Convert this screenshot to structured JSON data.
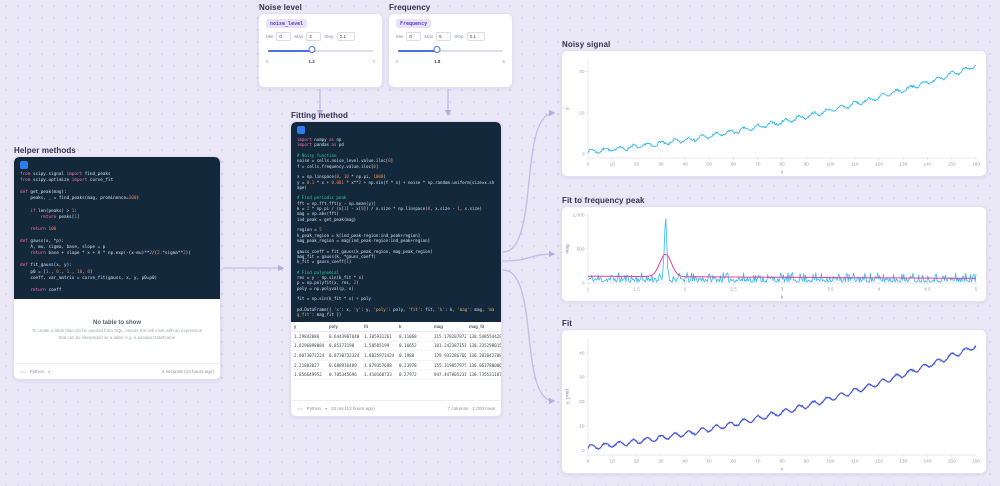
{
  "widgets": {
    "noise": {
      "title": "Noise level",
      "pill": "noise_level",
      "min_label": "Min",
      "min": "0",
      "max_label": "Max",
      "max": "3",
      "step_label": "Step",
      "step": "0.1",
      "slider_left": "0",
      "slider_right": "3",
      "value": "1.2",
      "fraction": 0.4
    },
    "frequency": {
      "title": "Frequency",
      "pill": "Frequency",
      "min_label": "Min",
      "min": "0",
      "max_label": "Max",
      "max": "5",
      "step_label": "Step",
      "step": "0.1",
      "slider_left": "0",
      "slider_right": "5",
      "value": "1.8",
      "fraction": 0.36
    }
  },
  "cells": {
    "helper": {
      "title": "Helper methods",
      "code_lines": [
        "from scipy.signal import find_peaks",
        "from scipy.optimize import curve_fit",
        "",
        "def get_peak(mag):",
        "    peaks, _ = find_peaks(mag, prominence=100)",
        "",
        "    if len(peaks) > 1:",
        "        return peaks[1]",
        "",
        "    return 100",
        "",
        "def gauss(x, *p):",
        "    A, mu, sigma, base, slope = p",
        "    return base + slope * x + A * np.exp(-(x-mu)**2/(2.*sigma**2))",
        "",
        "def fit_gauss(x, y):",
        "    p0 = [1., 0., 1., 10, 0]",
        "    coeff, var_matrix = curve_fit(gauss, x, y, p0=p0)",
        "",
        "    return coeff"
      ],
      "empty_title": "No table to show",
      "empty_body": "To create a table that can be queried from SQL, ensure the cell ends with an expression that can be interpreted as a table, e.g. a pandas DataFrame",
      "footer_language": "Python",
      "footer_runtime": "4 seconds (13 hours ago)"
    },
    "fitting": {
      "title": "Fitting method",
      "code_lines": [
        "import numpy as np",
        "import pandas as pd",
        "",
        "# Noisy function",
        "noise = cells.noise_level.value.iloc[0]",
        "f = cells.frequency.value.iloc[0]",
        "",
        "x = np.linspace(0, 10 * np.pi, 1000)",
        "y = 0.1 * x + 0.001 * x**2 + np.sin(f * x) + noise * np.random.uniform(size=x.shape)",
        "",
        "# Find periodic peak",
        "fft = np.fft.fft(y - np.mean(y))",
        "k = 2 * np.pi / (x[1] - x[0]) / x.size * np.linspace(0, x.size - 1, x.size)",
        "mag = np.abs(fft)",
        "ind_peak = get_peak(mag)",
        "",
        "region = 5",
        "k_peak_region = k[ind_peak-region:ind_peak+region]",
        "mag_peak_region = mag[ind_peak-region:ind_peak+region]",
        "",
        "gauss_coeff = fit_gauss(k_peak_region, mag_peak_region)",
        "mag_fit = gauss(k, *gauss_coeff)",
        "k_fit = gauss_coeff[1]",
        "",
        "# Find polynomial",
        "res = y - np.sin(k_fit * x)",
        "p = np.polyfit(x, res, 2)",
        "poly = np.polyval(p, x)",
        "",
        "fit = np.sin(k_fit * x) + poly",
        "",
        "pd.DataFrame({ 'x': x, 'y': y, 'poly': poly, 'fit': fit, 'k': k, 'mag': mag, 'mag_fit': mag_fit })"
      ],
      "table": {
        "columns": [
          "y",
          "poly",
          "fit",
          "k",
          "mag",
          "mag_fit"
        ],
        "rows": [
          [
            "1.29842086",
            "0.6443907648",
            "1.305931261",
            "0.11068",
            "215.1782078729",
            "130.548554429"
          ],
          [
            "1.8296898084",
            "0.85173198",
            "1.58585199",
            "0.16652",
            "101.2423871518",
            "130.235298015"
          ],
          [
            "2.0873073224",
            "0.8730732324",
            "1.8025973424",
            "0.1988",
            "129.9322867608",
            "136.202042788"
          ],
          [
            "2.21803027",
            "0.688916489",
            "1.879357688",
            "0.23978",
            "155.3198579755",
            "136.0637800063"
          ],
          [
            "1.856649952",
            "0.705345696",
            "1.410160733",
            "0.27972",
            "947.447805231",
            "130.735531187"
          ]
        ]
      },
      "footer_language": "Python",
      "footer_runtime": "24 ms (13 hours ago)",
      "footer_meta": "7 columns · 1,000 rows"
    }
  },
  "chart_data": [
    {
      "id": "noisy-signal",
      "type": "line",
      "title": "Noisy signal",
      "xlabel": "x",
      "ylabel": "y",
      "x_range": [
        0,
        160
      ],
      "y_range": [
        -2,
        46
      ],
      "x_ticks": [
        0,
        10,
        20,
        30,
        40,
        50,
        60,
        70,
        80,
        90,
        100,
        110,
        120,
        130,
        140,
        150,
        160
      ],
      "y_ticks": [
        0,
        20,
        40
      ],
      "grid": false,
      "legend": false,
      "series": [
        {
          "name": "y",
          "color": "#35b8ef",
          "width": 0.9,
          "description": "noisy rising oscillation: y = 0.1x + 0.001x^2 + sin(1.1x) + 1.2*U(0,1), from ~0 at x=0 to ~43 at x=160",
          "gen": {
            "kind": "noisy_trend",
            "n": 520,
            "c0": 0.5,
            "c1": 0.1,
            "c2": 0.001,
            "sin_amp": 1,
            "sin_freq": 1.1,
            "noise_amp": 1.2,
            "seed": 7
          }
        }
      ]
    },
    {
      "id": "fit-to-frequency-peak",
      "type": "line",
      "title": "Fit to frequency peak",
      "xlabel": "k",
      "ylabel": "mag",
      "x_range": [
        1,
        5
      ],
      "y_range": [
        0,
        1000
      ],
      "x_ticks": [
        1,
        1.5,
        2,
        2.5,
        3,
        3.5,
        4,
        4.5,
        5
      ],
      "y_ticks": [
        0,
        500,
        1000
      ],
      "y_tick_labels": [
        "0",
        "500",
        "1,000"
      ],
      "grid": false,
      "legend": false,
      "peak": {
        "k": 1.8,
        "mag": 950
      },
      "series": [
        {
          "name": "mag",
          "color": "#35b8ef",
          "width": 0.8,
          "description": "FFT magnitude: jagged low baseline (~15-155) with a sharp spike to ~950 at k=1.8",
          "gen": {
            "kind": "mag_noise",
            "n": 420,
            "base": 15,
            "rand_amp": 140,
            "peak_x": 1.8,
            "peak_amp": 930,
            "peak_sigma": 0.012,
            "seed": 11
          }
        },
        {
          "name": "mag_fit",
          "color": "#ef3ba2",
          "width": 1.0,
          "description": "Gaussian fit: baseline ~100 with smooth peak to ~430 at k=1.8",
          "gen": {
            "kind": "gauss",
            "n": 320,
            "base": 100,
            "slope": -8,
            "amp": 330,
            "mu": 1.8,
            "sigma": 0.06
          }
        }
      ]
    },
    {
      "id": "fit",
      "type": "line",
      "title": "Fit",
      "xlabel": "x",
      "ylabel": "y_pred",
      "x_range": [
        0,
        160
      ],
      "y_range": [
        -2,
        46
      ],
      "x_ticks": [
        0,
        10,
        20,
        30,
        40,
        50,
        60,
        70,
        80,
        90,
        100,
        110,
        120,
        130,
        140,
        150,
        160
      ],
      "y_ticks": [
        0,
        10,
        20,
        30,
        40
      ],
      "grid": false,
      "legend": false,
      "series": [
        {
          "name": "y",
          "color": "#4597f2",
          "width": 0.8,
          "description": "original noisy signal",
          "gen": {
            "kind": "noisy_trend",
            "n": 520,
            "c0": 0.5,
            "c1": 0.1,
            "c2": 0.001,
            "sin_amp": 1,
            "sin_freq": 1.1,
            "noise_amp": 1.2,
            "seed": 7
          }
        },
        {
          "name": "fit",
          "color": "#5b45d6",
          "width": 1.0,
          "description": "fitted curve sin(k_fit x) + poly running through center of noisy band",
          "gen": {
            "kind": "noisy_trend",
            "n": 520,
            "c0": 1.1,
            "c1": 0.1,
            "c2": 0.001,
            "sin_amp": 1,
            "sin_freq": 1.1,
            "noise_amp": 0,
            "seed": 1
          }
        }
      ]
    }
  ],
  "colors": {
    "accent_blue": "#35b8ef",
    "accent_magenta": "#ef3ba2",
    "fit_purple": "#5b45d6",
    "code_background": "#14283c",
    "pill_background": "#e7e1fb",
    "pill_text": "#5b43c9"
  }
}
